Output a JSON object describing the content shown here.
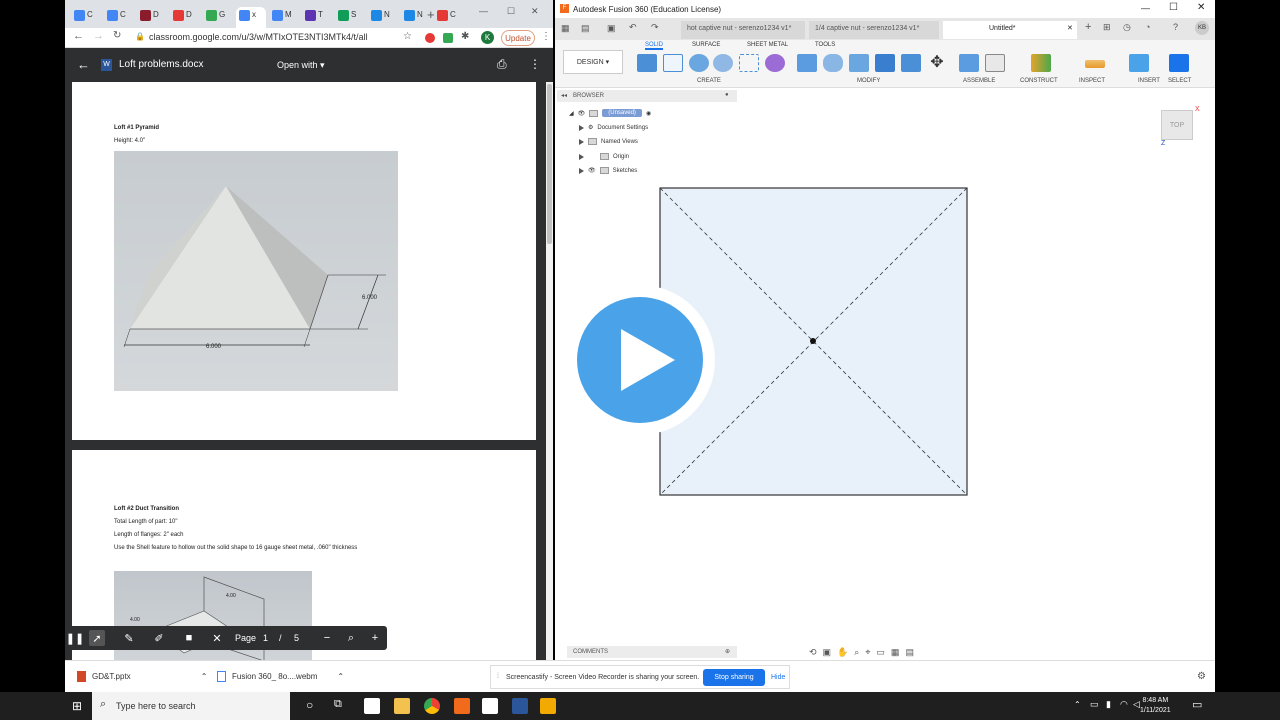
{
  "chrome": {
    "tabs": [
      {
        "label": "C",
        "color": "#4285f4"
      },
      {
        "label": "C",
        "color": "#4285f4"
      },
      {
        "label": "D",
        "color": "#8a1c2b"
      },
      {
        "label": "D",
        "color": "#e53935"
      },
      {
        "label": "G",
        "color": "#34a853"
      },
      {
        "label": "x",
        "color": "#4285f4"
      },
      {
        "label": "M",
        "color": "#4285f4"
      },
      {
        "label": "T",
        "color": "#5e35b1"
      },
      {
        "label": "S",
        "color": "#0f9d58"
      },
      {
        "label": "N",
        "color": "#1e88e5"
      },
      {
        "label": "N",
        "color": "#1e88e5"
      },
      {
        "label": "C",
        "color": "#e53935"
      }
    ],
    "new_tab": "+",
    "url": "classroom.google.com/u/3/w/MTIxOTE3NTI3MTk4/t/all",
    "update_label": "Update",
    "avatar_letter": "K"
  },
  "doc": {
    "title": "Loft problems.docx",
    "open_with": "Open with",
    "page1": {
      "heading": "Loft #1 Pyramid",
      "height_text": "Height: 4.0\"",
      "dim1": "6.000",
      "dim2": "6.000"
    },
    "page2": {
      "heading": "Loft #2 Duct Transition",
      "line1": "Total Length of part: 10\"",
      "line2": "Length of flanges: 2\" each",
      "line3": "Use the Shell feature to hollow out the solid shape to 16 gauge sheet metal, .060\" thickness",
      "dim_a": "4.00",
      "dim_b": "4.00"
    },
    "toolbar": {
      "page_label": "Page",
      "page_current": "1",
      "page_sep": "/",
      "page_total": "5"
    }
  },
  "fusion": {
    "title": "Autodesk Fusion 360 (Education License)",
    "tabs": [
      "hot captive nut - serenzo1234 v1*",
      "1/4 captive nut - serenzo1234 v1*",
      "Untitled*"
    ],
    "design_label": "DESIGN",
    "ribbon_tabs": [
      "SOLID",
      "SURFACE",
      "SHEET METAL",
      "TOOLS"
    ],
    "groups": [
      "CREATE",
      "MODIFY",
      "ASSEMBLE",
      "CONSTRUCT",
      "INSPECT",
      "INSERT",
      "SELECT"
    ],
    "browser_label": "BROWSER",
    "tree": [
      "(Unsaved)",
      "Document Settings",
      "Named Views",
      "Origin",
      "Sketches"
    ],
    "viewcube_label": "TOP",
    "comments_label": "COMMENTS",
    "user_initials": "KB"
  },
  "downloads": [
    {
      "name": "GD&T.pptx",
      "color": "#d24726"
    },
    {
      "name": "Fusion 360_ 8o....webm",
      "color": "#4285f4"
    }
  ],
  "share_bar": {
    "message": "Screencastify - Screen Video Recorder is sharing your screen.",
    "stop_label": "Stop sharing",
    "hide_label": "Hide"
  },
  "taskbar": {
    "search_placeholder": "Type here to search",
    "time": "8:48 AM",
    "date": "1/11/2021"
  },
  "colors": {
    "sketch_fill": "#e8f1fa",
    "play_blue": "#4aa3e8"
  }
}
